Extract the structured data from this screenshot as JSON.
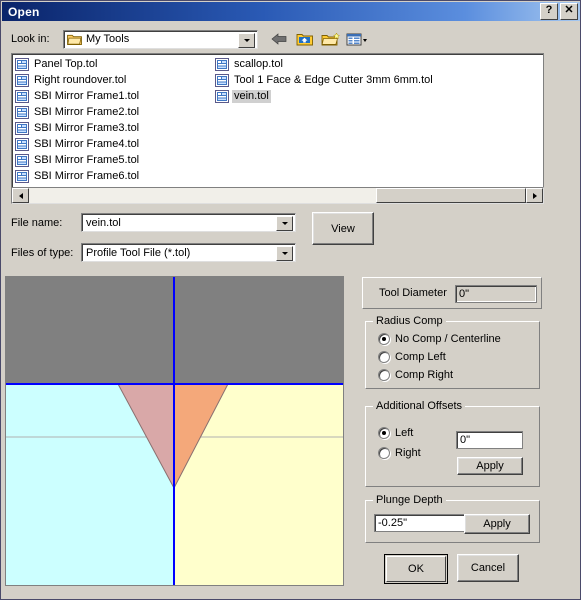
{
  "window": {
    "title": "Open",
    "help_button": "?",
    "close_button": "✕"
  },
  "lookin": {
    "label": "Look in:",
    "value": "My Tools",
    "folder_icon": "folder-icon",
    "dropdown_icon": "chevron-down-icon",
    "toolbar": [
      {
        "name": "back-icon",
        "tip": "Back"
      },
      {
        "name": "up-one-level-icon",
        "tip": "Up One Level"
      },
      {
        "name": "create-new-folder-icon",
        "tip": "Create New Folder"
      },
      {
        "name": "views-icon",
        "tip": "Views"
      }
    ]
  },
  "filelist": {
    "column1": [
      {
        "name": "Panel Top.tol",
        "selected": false
      },
      {
        "name": "Right roundover.tol",
        "selected": false
      },
      {
        "name": "SBI Mirror Frame1.tol",
        "selected": false
      },
      {
        "name": "SBI Mirror Frame2.tol",
        "selected": false
      },
      {
        "name": "SBI Mirror Frame3.tol",
        "selected": false
      },
      {
        "name": "SBI Mirror Frame4.tol",
        "selected": false
      },
      {
        "name": "SBI Mirror Frame5.tol",
        "selected": false
      },
      {
        "name": "SBI Mirror Frame6.tol",
        "selected": false
      }
    ],
    "column2": [
      {
        "name": "scallop.tol",
        "selected": false
      },
      {
        "name": "Tool 1 Face & Edge Cutter 3mm 6mm.tol",
        "selected": false
      },
      {
        "name": "vein.tol",
        "selected": true
      }
    ]
  },
  "filename": {
    "label": "File name:",
    "value": "vein.tol"
  },
  "filetype": {
    "label": "Files of type:",
    "value": "Profile Tool File (*.tol)"
  },
  "view_button": {
    "label": "View"
  },
  "tool_diameter": {
    "label": "Tool Diameter",
    "value": "0\""
  },
  "radius_comp": {
    "title": "Radius Comp",
    "options": [
      {
        "label": "No Comp / Centerline",
        "checked": true
      },
      {
        "label": "Comp Left",
        "checked": false
      },
      {
        "label": "Comp Right",
        "checked": false
      }
    ]
  },
  "additional_offsets": {
    "title": "Additional Offsets",
    "options": [
      {
        "label": "Left",
        "checked": true
      },
      {
        "label": "Right",
        "checked": false
      }
    ],
    "value": "0\"",
    "apply_label": "Apply"
  },
  "plunge_depth": {
    "title": "Plunge Depth",
    "value": "-0.25\"",
    "apply_label": "Apply"
  },
  "buttons": {
    "ok": "OK",
    "cancel": "Cancel"
  },
  "preview": {
    "name": "tool-profile-preview",
    "colors": {
      "material_top": "#808080",
      "quadrant_left": "#ccffff",
      "quadrant_right": "#ffffcc",
      "axis": "#0000ff",
      "tool_left": "#d9a8a8",
      "tool_right": "#f4a87a",
      "guide_line": "#b0b0b0"
    }
  }
}
